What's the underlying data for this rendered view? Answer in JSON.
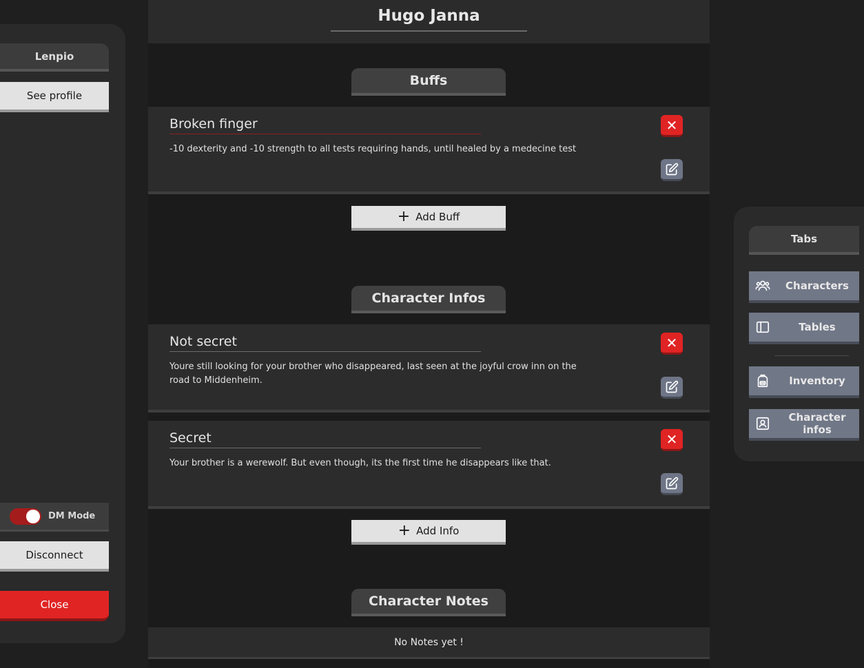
{
  "left_panel": {
    "user_name": "Lenpio",
    "see_profile_label": "See profile",
    "dm_mode_label": "DM Mode",
    "dm_mode_on": true,
    "disconnect_label": "Disconnect",
    "close_label": "Close"
  },
  "character": {
    "name": "Hugo Janna"
  },
  "buffs": {
    "title": "Buffs",
    "items": [
      {
        "title": "Broken finger",
        "description": "-10 dexterity and -10 strength to all tests requiring hands, until healed by a medecine test"
      }
    ],
    "add_label": "Add Buff"
  },
  "infos": {
    "title": "Character Infos",
    "items": [
      {
        "title": "Not secret",
        "description": "Youre still looking for your brother who disappeared, last seen at the joyful crow inn on the road to Middenheim."
      },
      {
        "title": "Secret",
        "description": "Your brother is a werewolf. But even though, its the first time he disappears like that."
      }
    ],
    "add_label": "Add Info"
  },
  "notes": {
    "title": "Character Notes",
    "empty_text": "No Notes yet !"
  },
  "tabs_panel": {
    "title": "Tabs",
    "items": [
      {
        "label": "Characters",
        "icon": "users-icon"
      },
      {
        "label": "Tables",
        "icon": "layout-icon"
      },
      {
        "label": "Inventory",
        "icon": "backpack-icon"
      },
      {
        "label": "Character infos",
        "icon": "id-card-icon"
      }
    ]
  },
  "colors": {
    "accent_red": "#e02424",
    "tab_blue_gray": "#707787",
    "background": "#1f1f1f"
  }
}
